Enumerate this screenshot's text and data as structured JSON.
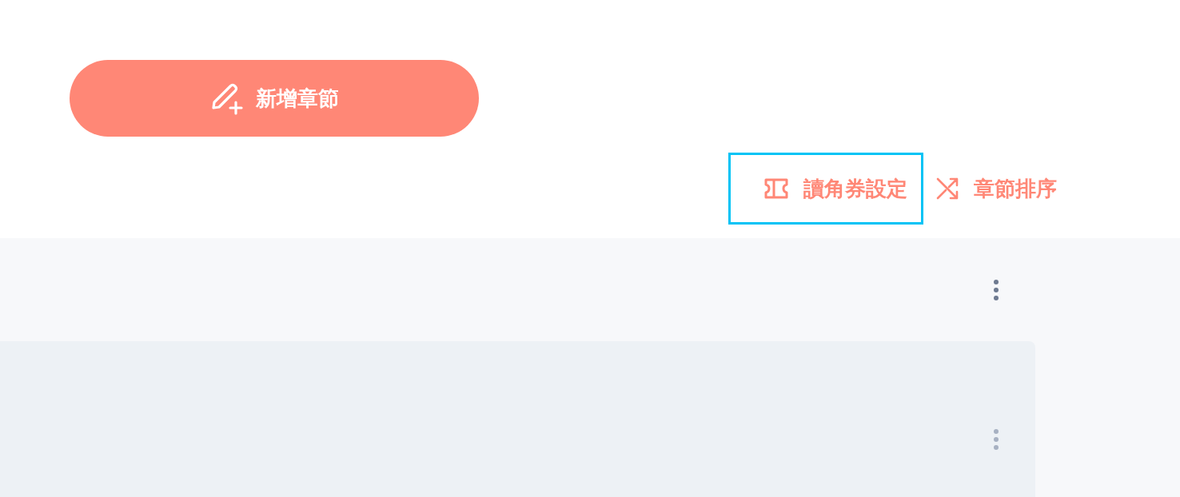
{
  "add_button": {
    "label": "新增章節"
  },
  "actions": [
    {
      "kind": "ticket",
      "label": "讀角券設定",
      "highlighted": true
    },
    {
      "kind": "shuffle",
      "label": "章節排序",
      "highlighted": false
    }
  ]
}
